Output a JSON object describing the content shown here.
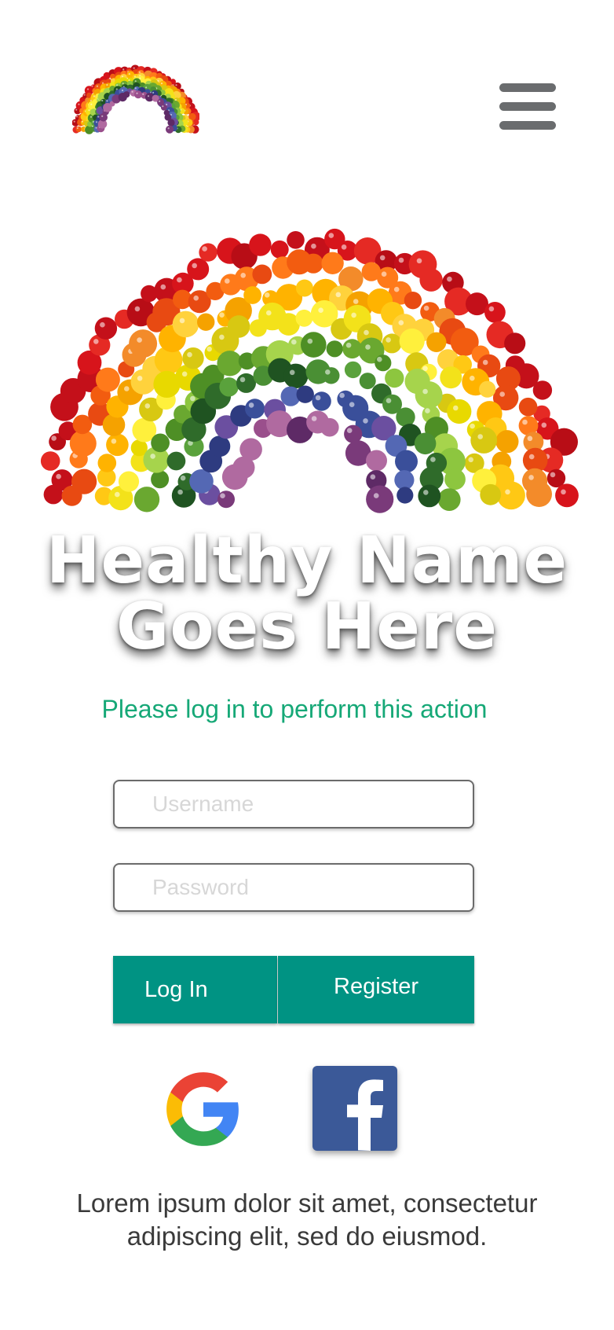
{
  "header": {
    "logo_icon": "fruit-rainbow-logo-icon",
    "menu_icon": "hamburger-menu-icon"
  },
  "hero": {
    "image": "fruit-and-vegetable-rainbow",
    "title": "Healthy Name Goes Here"
  },
  "login": {
    "notice": "Please log in to perform this action",
    "username_placeholder": "Username",
    "password_placeholder": "Password",
    "login_label": "Log In",
    "register_label": "Register"
  },
  "social": {
    "google_icon": "google-g-icon",
    "facebook_icon": "facebook-f-icon"
  },
  "footer": {
    "text": "Lorem ipsum dolor sit amet, consectetur adipiscing elit, sed do eiusmod."
  },
  "colors": {
    "accent": "#009383",
    "notice": "#16a877",
    "menu": "#6a6c6e",
    "facebook": "#3b5998"
  }
}
